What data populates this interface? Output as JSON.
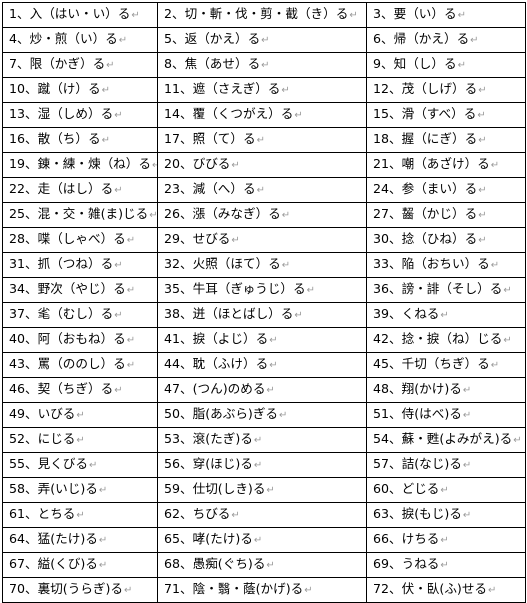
{
  "return_mark": "↵",
  "rows": [
    [
      "1、入（はい・い）る",
      "2、切・斬・伐・剪・截（き）る",
      "3、要（い）る"
    ],
    [
      "4、炒・煎（い）る",
      "5、返（かえ）る",
      "6、帰（かえ）る"
    ],
    [
      "7、限（かぎ）る",
      "8、焦（あせ）る",
      "9、知（し）る"
    ],
    [
      "10、蹴（け）る",
      "11、遮（さえぎ）る",
      "12、茂（しげ）る"
    ],
    [
      "13、湿（しめ）る",
      "14、覆（くつがえ）る",
      "15、滑（すべ）る"
    ],
    [
      "16、散（ち）る",
      "17、照（て）る",
      "18、握（にぎ）る"
    ],
    [
      "19、錬・練・煉（ね）る",
      "20、びびる",
      "21、嘲（あざけ）る"
    ],
    [
      "22、走（はし）る",
      "23、減（へ）る",
      "24、参（まい）る"
    ],
    [
      "25、混・交・雑(ま)じる",
      "26、漲（みなぎ）る",
      "27、齧（かじ）る"
    ],
    [
      "28、喋（しゃべ）る",
      "29、せびる",
      "30、捻（ひね）る"
    ],
    [
      "31、抓（つね）る",
      "32、火照（ほて）る",
      "33、陥（おちい）る"
    ],
    [
      "34、野次（やじ）る",
      "35、牛耳（ぎゅうじ）る",
      "36、謗・誹（そし）る"
    ],
    [
      "37、毟（むし）る",
      "38、迸（ほとばし）る",
      "39、くねる"
    ],
    [
      "40、阿（おもね）る",
      "41、捩（よじ）る",
      "42、捻・捩（ね）じる"
    ],
    [
      "43、罵（ののし）る",
      "44、耽（ふけ）る",
      "45、千切（ちぎ）る"
    ],
    [
      "46、契（ちぎ）る",
      "47、(つん)のめる",
      "48、翔(かけ)る"
    ],
    [
      "49、いびる",
      "50、脂(あぶら)ぎる",
      "51、侍(はべ)る"
    ],
    [
      "52、にじる",
      "53、滾(たぎ)る",
      "54、蘇・甦(よみがえ)る"
    ],
    [
      "55、見くびる",
      "56、穿(ほじ)る",
      "57、詰(なじ)る"
    ],
    [
      "58、弄(いじ)る",
      "59、仕切(しき)る",
      "60、どじる"
    ],
    [
      "61、とちる",
      "62、ちびる",
      "63、捩(もじ)る"
    ],
    [
      "64、猛(たけ)る",
      "65、哮(たけ)る",
      "66、けちる"
    ],
    [
      "67、縊(くび)る",
      "68、愚痴(ぐち)る",
      "69、うねる"
    ],
    [
      "70、裏切(うらぎ)る",
      "71、陰・翳・蔭(かげ)る",
      "72、伏・臥(ふ)せる"
    ]
  ]
}
